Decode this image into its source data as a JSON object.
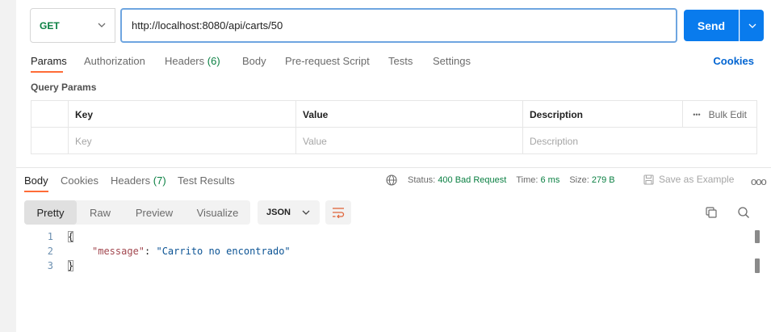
{
  "request": {
    "method": "GET",
    "url": "http://localhost:8080/api/carts/50",
    "send_label": "Send"
  },
  "request_tabs": {
    "params": "Params",
    "authorization": "Authorization",
    "headers": "Headers",
    "headers_count": "(6)",
    "body": "Body",
    "prerequest": "Pre-request Script",
    "tests": "Tests",
    "settings": "Settings",
    "cookies": "Cookies"
  },
  "query_params": {
    "title": "Query Params",
    "columns": {
      "key": "Key",
      "value": "Value",
      "description": "Description"
    },
    "bulk_edit": "Bulk Edit",
    "more": "•••",
    "placeholders": {
      "key": "Key",
      "value": "Value",
      "description": "Description"
    }
  },
  "response_tabs": {
    "body": "Body",
    "cookies": "Cookies",
    "headers": "Headers",
    "headers_count": "(7)",
    "test_results": "Test Results"
  },
  "response_status": {
    "status_label": "Status:",
    "status_value": "400 Bad Request",
    "time_label": "Time:",
    "time_value": "6 ms",
    "size_label": "Size:",
    "size_value": "279 B",
    "save_example": "Save as Example",
    "more": "ooo"
  },
  "format_bar": {
    "modes": [
      "Pretty",
      "Raw",
      "Preview",
      "Visualize"
    ],
    "active_mode": "Pretty",
    "language": "JSON"
  },
  "response_body": {
    "line_numbers": [
      "1",
      "2",
      "3"
    ],
    "open_brace": "{",
    "json_key": "\"message\"",
    "colon": ": ",
    "json_value": "\"Carrito no encontrado\"",
    "close_brace": "}"
  },
  "colors": {
    "accent": "#ff6c37",
    "send_blue": "#097bed",
    "method_green": "#0b8043",
    "status_green": "#0b8043",
    "link_blue": "#0265d2"
  },
  "icons": {
    "method_dropdown": "chevron-down-icon",
    "send_dropdown": "chevron-down-icon",
    "globe": "globe-icon",
    "save": "save-icon",
    "wrap": "wrap-lines-icon",
    "copy": "copy-icon",
    "search": "search-icon"
  }
}
